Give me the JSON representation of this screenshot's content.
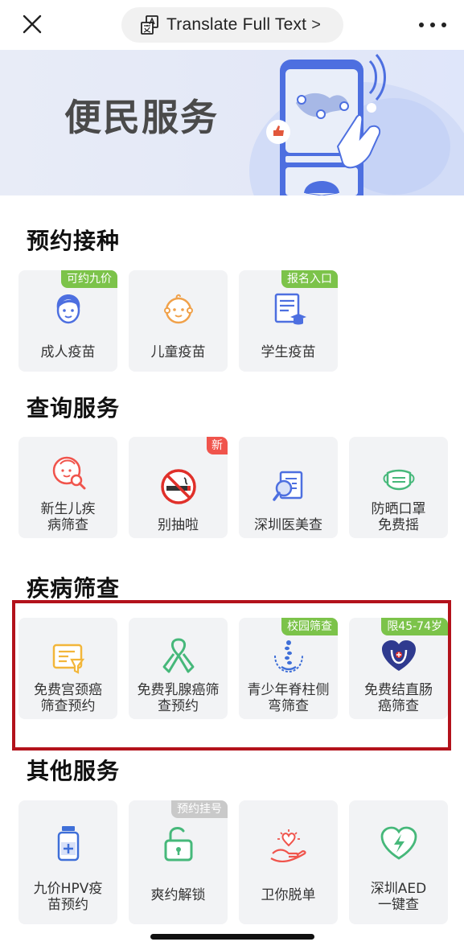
{
  "topbar": {
    "translate_label": "Translate Full Text",
    "translate_chevron": ">"
  },
  "banner": {
    "title": "便民服务"
  },
  "sections": {
    "vaccine": {
      "title": "预约接种",
      "items": [
        {
          "label": "成人疫苗",
          "badge": "可约九价",
          "icon": "adult-face-icon"
        },
        {
          "label": "儿童疫苗",
          "badge": "",
          "icon": "child-face-icon"
        },
        {
          "label": "学生疫苗",
          "badge": "报名入口",
          "icon": "student-document-icon"
        }
      ]
    },
    "query": {
      "title": "查询服务",
      "items": [
        {
          "label_1": "新生儿疾",
          "label_2": "病筛查",
          "icon": "newborn-search-icon"
        },
        {
          "label": "别抽啦",
          "badge": "新",
          "icon": "no-smoking-icon"
        },
        {
          "label": "深圳医美查",
          "icon": "document-search-icon"
        },
        {
          "label_1": "防晒口罩",
          "label_2": "免费摇",
          "icon": "face-mask-icon"
        }
      ]
    },
    "screening": {
      "title": "疾病筛查",
      "items": [
        {
          "label_1": "免费宫颈癌",
          "label_2": "筛查预约",
          "icon": "screening-form-icon"
        },
        {
          "label_1": "免费乳腺癌筛",
          "label_2": "查预约",
          "icon": "pink-ribbon-icon"
        },
        {
          "label_1": "青少年脊柱侧",
          "label_2": "弯筛查",
          "badge": "校园筛查",
          "icon": "spine-icon"
        },
        {
          "label_1": "免费结直肠",
          "label_2": "癌筛查",
          "badge": "限45-74岁",
          "icon": "colon-heart-icon"
        }
      ]
    },
    "other": {
      "title": "其他服务",
      "items": [
        {
          "label_1": "九价HPV疫",
          "label_2": "苗预约",
          "icon": "vaccine-vial-icon"
        },
        {
          "label": "爽约解锁",
          "badge": "预约挂号",
          "icon": "unlock-icon"
        },
        {
          "label": "卫你脱单",
          "icon": "hand-heart-icon"
        },
        {
          "label_1": "深圳AED",
          "label_2": "一键查",
          "icon": "aed-heart-icon"
        }
      ]
    }
  },
  "colors": {
    "badge_green": "#7cc34a",
    "badge_red": "#f0544c",
    "badge_grey": "#c9c9c9",
    "highlight_border": "#b3121b",
    "card_bg": "#f2f3f5"
  }
}
